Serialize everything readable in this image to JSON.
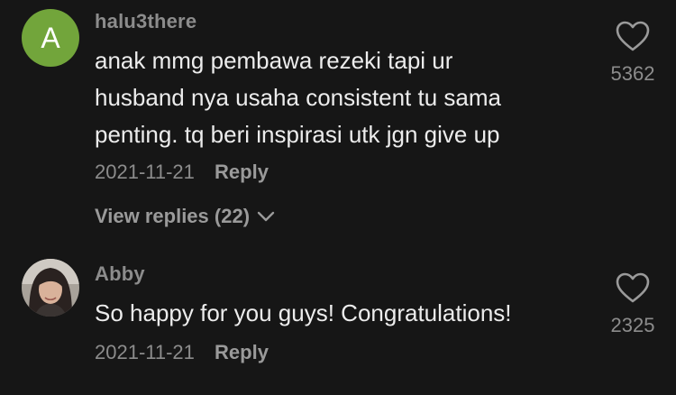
{
  "comments": [
    {
      "avatar_letter": "A",
      "avatar_color": "#72a53b",
      "username": "halu3there",
      "lines": [
        "anak mmg pembawa rezeki tapi ur",
        "husband nya usaha consistent tu sama",
        "penting. tq beri inspirasi utk jgn give up"
      ],
      "date": "2021-11-21",
      "reply_label": "Reply",
      "view_replies_label": "View replies (22)",
      "likes": "5362"
    },
    {
      "avatar_icon": "profile-photo",
      "username": "Abby",
      "lines": [
        "So happy for you guys! Congratulations!"
      ],
      "date": "2021-11-21",
      "reply_label": "Reply",
      "likes": "2325"
    }
  ],
  "colors": {
    "background": "#161616",
    "text": "#ececec",
    "muted": "#8c8c8c"
  }
}
